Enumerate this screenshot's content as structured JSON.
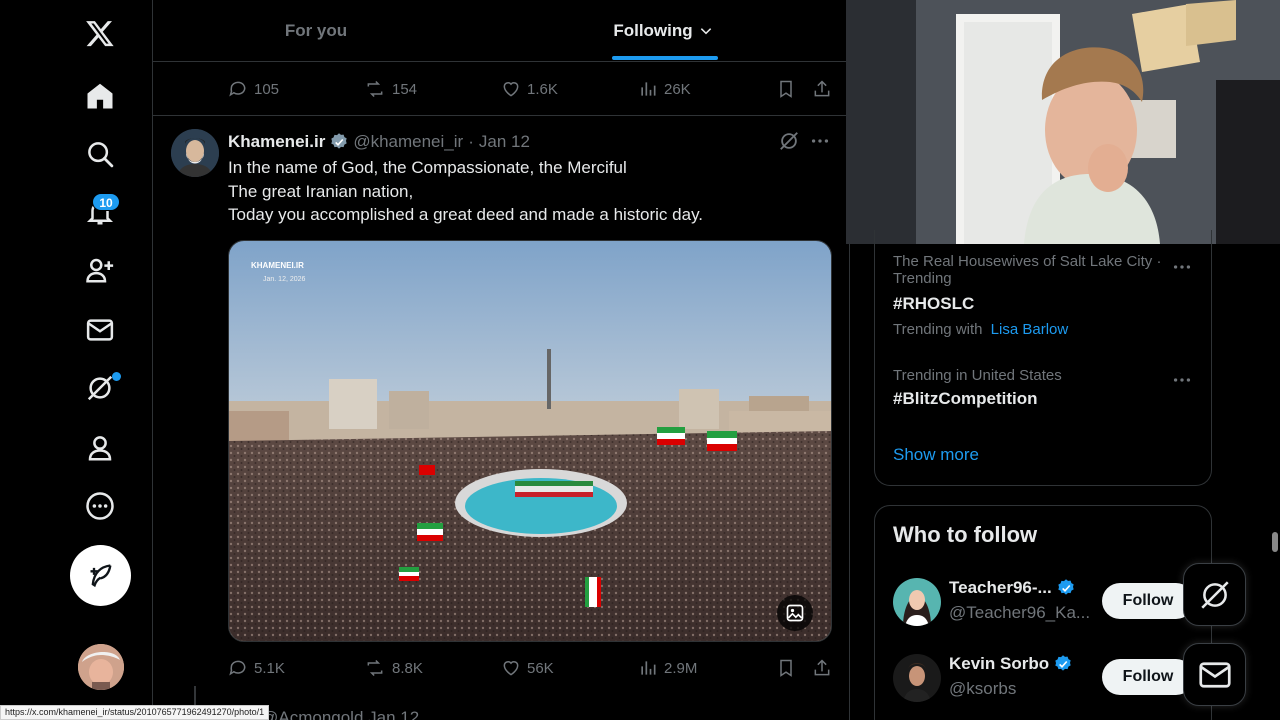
{
  "nav": {
    "notifications_badge": "10"
  },
  "tabs": {
    "for_you": "For you",
    "following": "Following"
  },
  "prev_tweet_actions": {
    "replies": "105",
    "reposts": "154",
    "likes": "1.6K",
    "views": "26K"
  },
  "tweet": {
    "name": "Khamenei.ir",
    "handle": "@khamenei_ir",
    "separator": "·",
    "date": "Jan 12",
    "lines": [
      "In the name of God, the Compassionate, the Merciful",
      "The great Iranian nation,",
      "Today you accomplished a great deed and made a historic day."
    ],
    "media": {
      "watermark": "KHAMENEI.IR",
      "date": "Jan. 12, 2026"
    },
    "actions": {
      "replies": "5.1K",
      "reposts": "8.8K",
      "likes": "56K",
      "views": "2.9M"
    }
  },
  "next_tweet": {
    "name_partial": "ack",
    "handle_partial": "@Acmongold",
    "date": "Jan 12"
  },
  "url_status": "https://x.com/khamenei_ir/status/2010765771962491270/photo/1",
  "trends": [
    {
      "meta": "The Real Housewives of Salt Lake City · Trending",
      "meta_line1": "The Real Housewives of Salt Lake City ·",
      "meta_line2": "Trending",
      "title": "#RHOSLC",
      "trending_with_label": "Trending with",
      "trending_with_link": "Lisa Barlow"
    },
    {
      "meta": "Trending in United States",
      "title": "#BlitzCompetition"
    }
  ],
  "show_more": "Show more",
  "who_to_follow": {
    "title": "Who to follow",
    "users": [
      {
        "name": "Teacher96-...",
        "handle": "@Teacher96_Ka...",
        "button": "Follow"
      },
      {
        "name": "Kevin Sorbo",
        "handle": "@ksorbs",
        "button": "Follow"
      }
    ]
  },
  "colors": {
    "accent": "#1d9bf0",
    "text": "#e7e9ea",
    "muted": "#71767b",
    "border": "#2f3336",
    "background": "#000000"
  }
}
